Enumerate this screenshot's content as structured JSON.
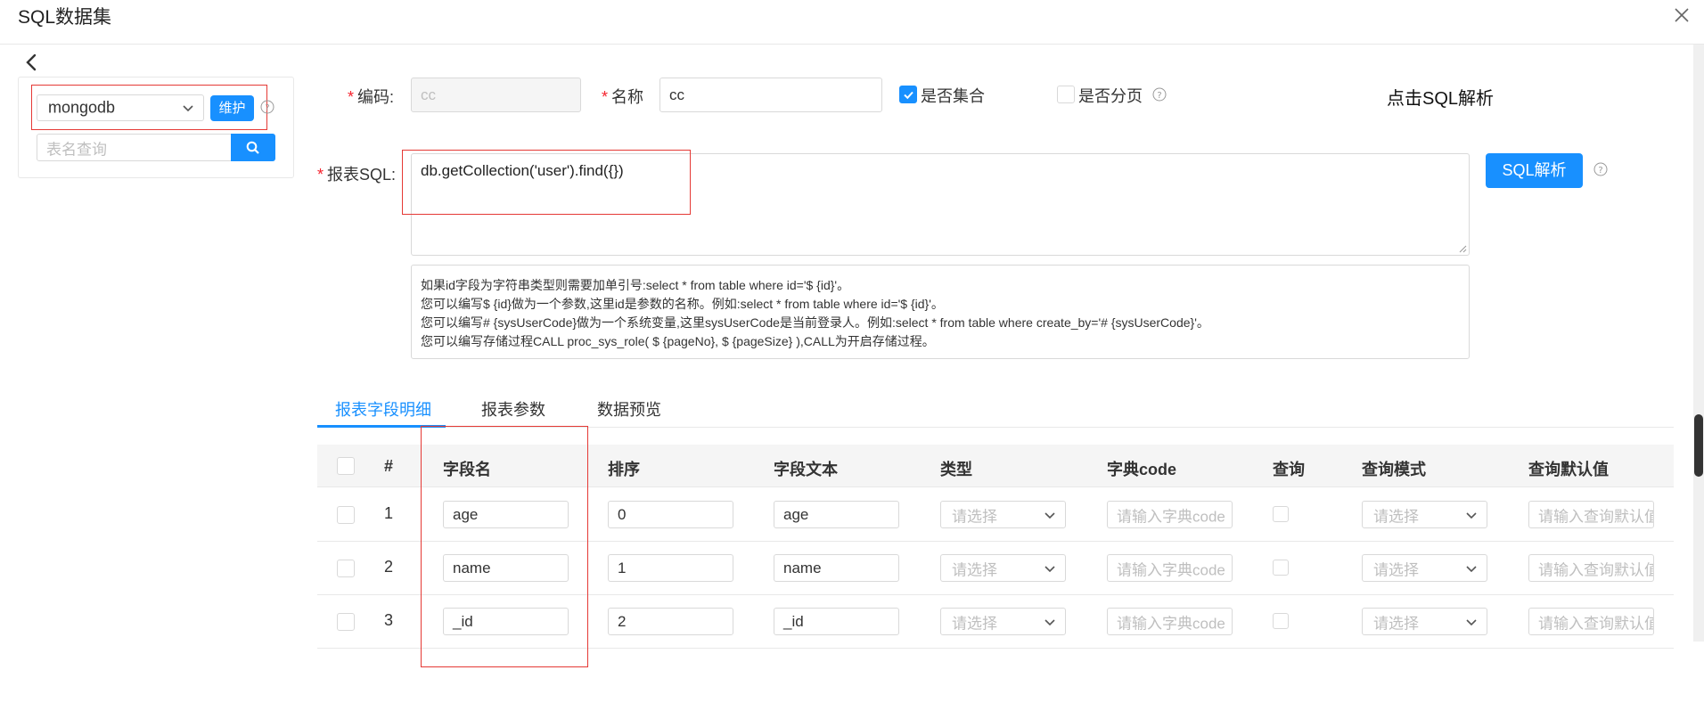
{
  "window": {
    "title": "SQL数据集"
  },
  "left_panel": {
    "datasource_value": "mongodb",
    "maintain_label": "维护",
    "table_search_placeholder": "表名查询"
  },
  "form": {
    "code_label": "编码:",
    "code_value": "cc",
    "name_label": "名称",
    "name_value": "cc",
    "is_collection_label": "是否集合",
    "is_collection_checked": true,
    "is_paging_label": "是否分页",
    "is_paging_checked": false,
    "sql_label": "报表SQL:",
    "sql_value": "db.getCollection('user').find({})",
    "sql_parse_label": "SQL解析",
    "hints": [
      "如果id字段为字符串类型则需要加单引号:select * from table where id='$ {id}'。",
      "您可以编写$ {id}做为一个参数,这里id是参数的名称。例如:select * from table where id='$ {id}'。",
      "您可以编写# {sysUserCode}做为一个系统变量,这里sysUserCode是当前登录人。例如:select * from table where create_by='# {sysUserCode}'。",
      "您可以编写存储过程CALL proc_sys_role( $ {pageNo}, $ {pageSize} ),CALL为开启存储过程。"
    ]
  },
  "annotation": "点击SQL解析",
  "tabs": [
    {
      "label": "报表字段明细",
      "active": true
    },
    {
      "label": "报表参数",
      "active": false
    },
    {
      "label": "数据预览",
      "active": false
    }
  ],
  "table": {
    "headers": [
      "#",
      "字段名",
      "排序",
      "字段文本",
      "类型",
      "字典code",
      "查询",
      "查询模式",
      "查询默认值"
    ],
    "rows": [
      {
        "num": "1",
        "field": "age",
        "order": "0",
        "text": "age"
      },
      {
        "num": "2",
        "field": "name",
        "order": "1",
        "text": "name"
      },
      {
        "num": "3",
        "field": "_id",
        "order": "2",
        "text": "_id"
      }
    ],
    "type_placeholder": "请选择",
    "dict_placeholder": "请输入字典code",
    "mode_placeholder": "请选择",
    "default_placeholder": "请输入查询默认值"
  },
  "colors": {
    "primary": "#1890ff",
    "required": "#f5222d",
    "annotation_box": "#e53935"
  },
  "icons": [
    "close-icon",
    "back-arrow-icon",
    "chevron-down-icon",
    "search-icon",
    "help-circle-icon",
    "check-icon"
  ]
}
